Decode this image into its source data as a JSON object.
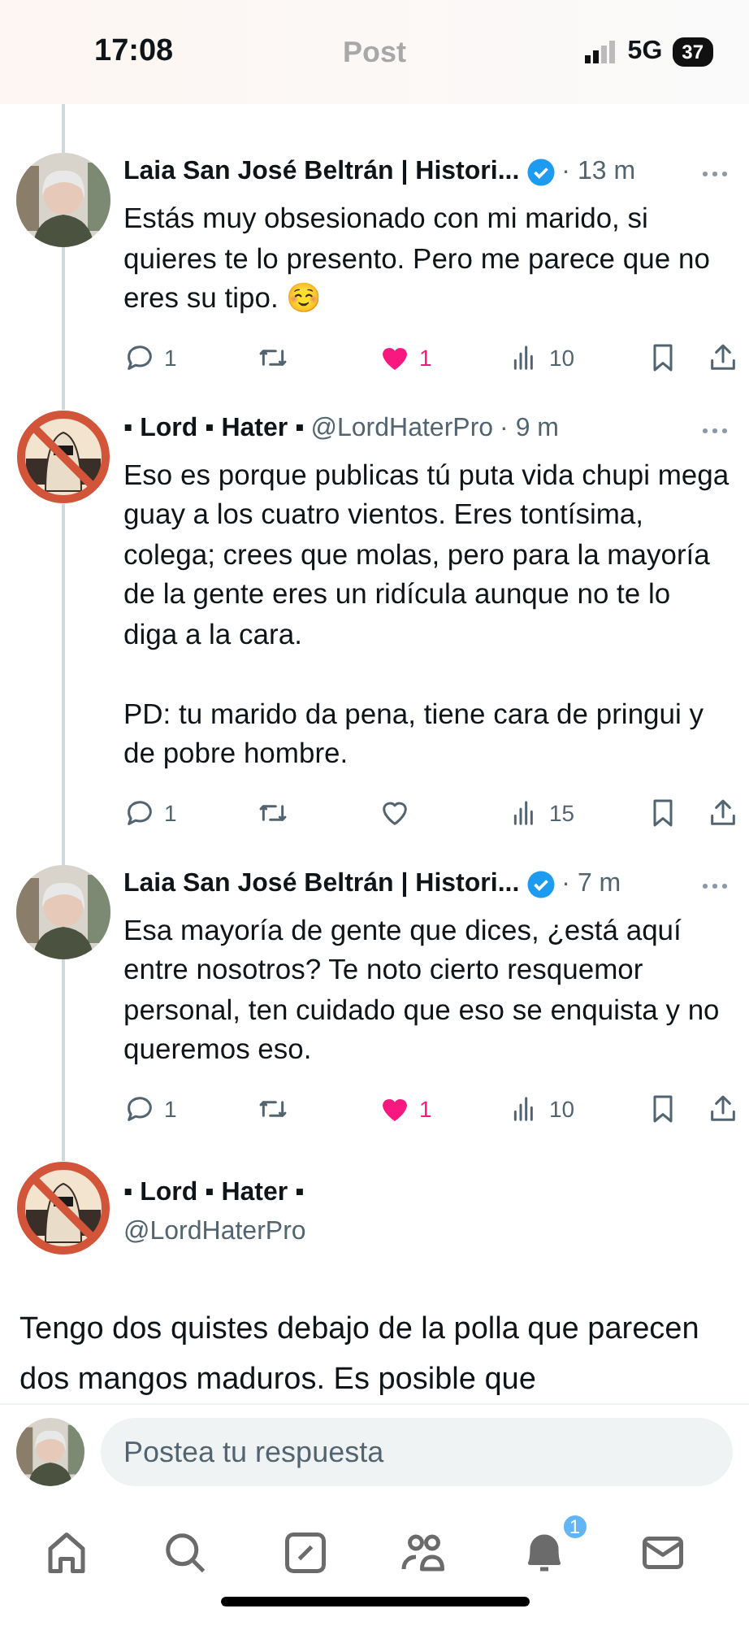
{
  "status_bar": {
    "time": "17:08",
    "network": "5G",
    "battery": "37"
  },
  "header": {
    "title": "Post"
  },
  "replies": [
    {
      "name": "Laia San José Beltrán | Histori...",
      "verified": true,
      "time": "· 13 m",
      "text": "Estás muy obsesionado con mi marido, si quieres te lo presento. Pero me parece que no eres su tipo. ☺️",
      "replies": "1",
      "liked": true,
      "likes": "1",
      "views": "10"
    },
    {
      "name": "▪ Lord ▪ Hater ▪",
      "handle": "@LordHaterPro",
      "time": "· 9 m",
      "text": "Eso es porque publicas tú puta vida chupi mega guay a los cuatro vientos. Eres tontísima, colega; crees que molas, pero para la mayoría de la gente eres un ridícula aunque no te lo diga a la cara.\n\nPD: tu marido da pena, tiene cara de pringui y de pobre hombre.",
      "replies": "1",
      "liked": false,
      "views": "15"
    },
    {
      "name": "Laia San José Beltrán | Histori...",
      "verified": true,
      "time": "· 7 m",
      "text": "Esa mayoría de gente que dices, ¿está aquí entre nosotros? Te noto cierto resquemor personal, ten cuidado que eso se enquista y no queremos eso.",
      "replies": "1",
      "liked": true,
      "likes": "1",
      "views": "10"
    }
  ],
  "main_post": {
    "name": "▪ Lord ▪ Hater ▪",
    "handle": "@LordHaterPro",
    "text": "Tengo dos quistes debajo de la polla que parecen dos mangos maduros. Es posible que"
  },
  "reply_bar": {
    "placeholder": "Postea tu respuesta"
  },
  "nav": [
    {
      "kind": "home"
    },
    {
      "kind": "search"
    },
    {
      "kind": "compose"
    },
    {
      "kind": "communities"
    },
    {
      "kind": "notifications",
      "badge": "1"
    },
    {
      "kind": "messages"
    }
  ]
}
